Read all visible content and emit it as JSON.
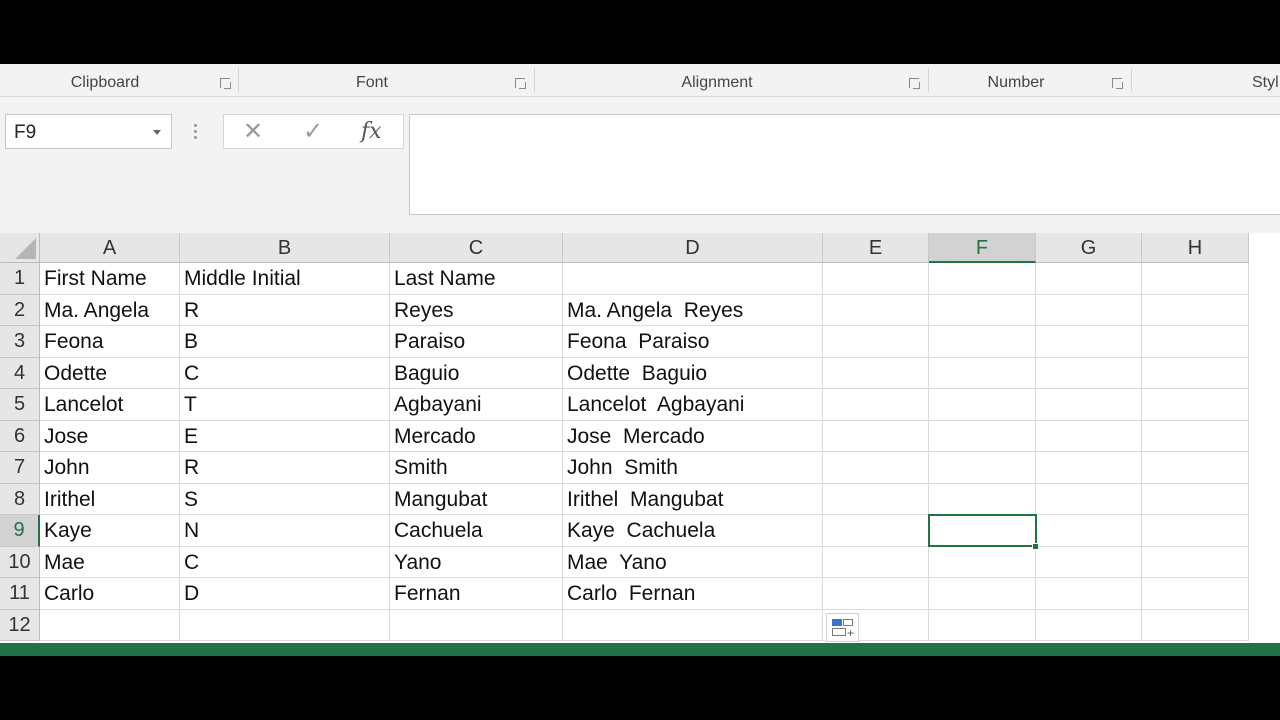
{
  "ribbon": {
    "groups": [
      {
        "label": "Clipboard"
      },
      {
        "label": "Font"
      },
      {
        "label": "Alignment"
      },
      {
        "label": "Number"
      },
      {
        "label": "Styl"
      }
    ]
  },
  "formula_bar": {
    "name_box": "F9",
    "cancel_icon": "✕",
    "enter_icon": "✓",
    "function_icon": "fx",
    "content": ""
  },
  "sheet": {
    "columns": [
      "A",
      "B",
      "C",
      "D",
      "E",
      "F",
      "G",
      "H"
    ],
    "rows": [
      "1",
      "2",
      "3",
      "4",
      "5",
      "6",
      "7",
      "8",
      "9",
      "10",
      "11",
      "12"
    ],
    "active_cell": "F9",
    "cells": [
      [
        "First Name",
        "Middle Initial",
        "Last Name",
        ""
      ],
      [
        "Ma. Angela",
        "R",
        "Reyes",
        "Ma. Angela  Reyes"
      ],
      [
        "Feona",
        "B",
        "Paraiso",
        "Feona  Paraiso"
      ],
      [
        "Odette",
        "C",
        "Baguio",
        "Odette  Baguio"
      ],
      [
        "Lancelot",
        "T",
        "Agbayani",
        "Lancelot  Agbayani"
      ],
      [
        "Jose",
        "E",
        "Mercado",
        "Jose  Mercado"
      ],
      [
        "John",
        "R",
        "Smith",
        "John  Smith"
      ],
      [
        "Irithel",
        "S",
        "Mangubat",
        "Irithel  Mangubat"
      ],
      [
        "Kaye",
        "N",
        "Cachuela",
        "Kaye  Cachuela"
      ],
      [
        "Mae",
        "C",
        "Yano",
        "Mae  Yano"
      ],
      [
        "Carlo",
        "D",
        "Fernan",
        "Carlo  Fernan"
      ],
      [
        "",
        "",
        "",
        ""
      ]
    ]
  },
  "colors": {
    "accent": "#217346",
    "header_bg": "#e6e6e6",
    "ribbon_bg": "#f3f3f3"
  }
}
